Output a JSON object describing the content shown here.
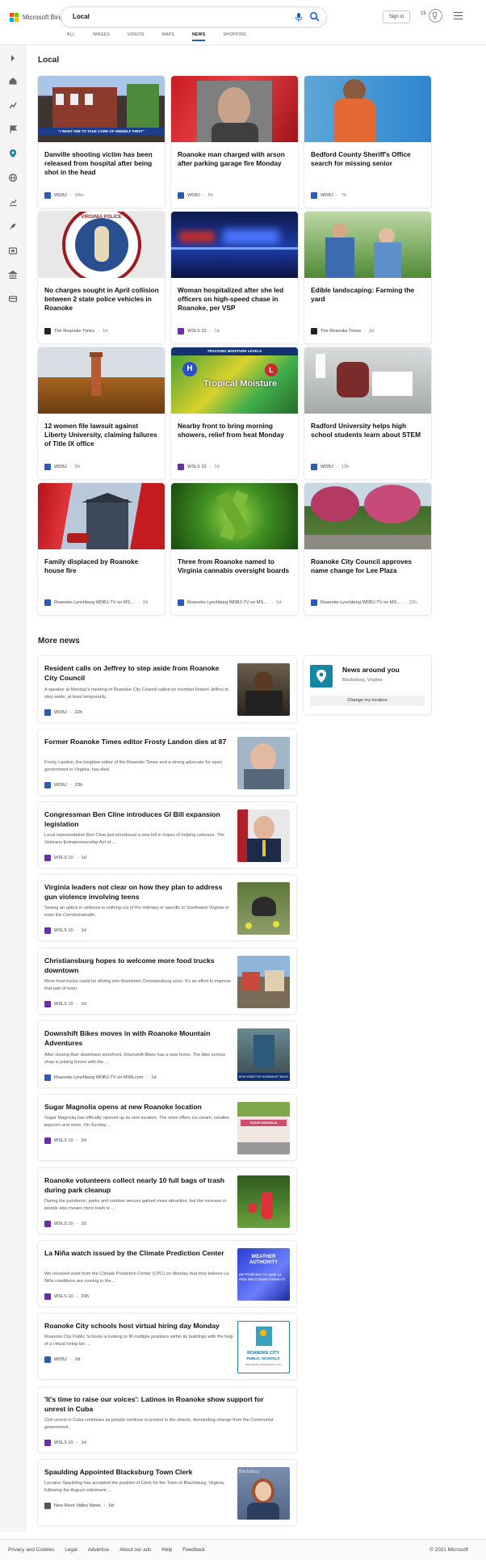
{
  "brand": {
    "name": "Microsoft Bing",
    "colors": [
      "#f25022",
      "#7fba00",
      "#00a4ef",
      "#ffb900"
    ]
  },
  "search": {
    "query": "Local"
  },
  "header": {
    "sign_in": "Sign in",
    "reward_count": "15"
  },
  "tabs": [
    {
      "label": "ALL"
    },
    {
      "label": "IMAGES"
    },
    {
      "label": "VIDEOS"
    },
    {
      "label": "MAPS"
    },
    {
      "label": "NEWS",
      "active": true
    },
    {
      "label": "SHOPPING"
    }
  ],
  "accent": "#1f5fc5",
  "local": {
    "title": "Local",
    "cards": [
      {
        "title": "Danville shooting victim has been released from hospital after being shot in the head",
        "source": "WDBJ",
        "ago": "34m",
        "logo": "w",
        "img_caption": "\"I WANT HIM TO TAKE CARE OF HIMSELF FIRST\""
      },
      {
        "title": "Roanoke man charged with arson after parking garage fire Monday",
        "source": "WDBJ",
        "ago": "5h",
        "logo": "w"
      },
      {
        "title": "Bedford County Sheriff's Office search for missing senior",
        "source": "WDBJ",
        "ago": "7h",
        "logo": "w"
      },
      {
        "title": "No charges sought in April collision between 2 state police vehicles in Roanoke",
        "source": "The Roanoke Times",
        "ago": "1d",
        "logo": "t",
        "img_caption": "VIRGINIA POLICE"
      },
      {
        "title": "Woman hospitalized after she led officers on high-speed chase in Roanoke, per VSP",
        "source": "WSLS 10",
        "ago": "1d",
        "logo": "s"
      },
      {
        "title": "Edible landscaping: Farming the yard",
        "source": "The Roanoke Times",
        "ago": "2d",
        "logo": "t"
      },
      {
        "title": "12 women file lawsuit against Liberty University, claiming failures of Title IX office",
        "source": "WDBJ",
        "ago": "5h",
        "logo": "w"
      },
      {
        "title": "Nearby front to bring morning showers, relief from heat Monday",
        "source": "WSLS 10",
        "ago": "1d",
        "logo": "s",
        "img_caption": "TRACKING MOISTURE LEVELS",
        "img_caption2": "Tropical Moisture"
      },
      {
        "title": "Radford University helps high school students learn about STEM",
        "source": "WDBJ",
        "ago": "13h",
        "logo": "w"
      },
      {
        "title": "Family displaced by Roanoke house fire",
        "source": "Roanoke-Lynchburg WDBJ-TV on MSN...",
        "ago": "2d",
        "logo": "w"
      },
      {
        "title": "Three from Roanoke named to Virginia cannabis oversight boards",
        "source": "Roanoke-Lynchburg WDBJ-TV on MSN...",
        "ago": "1d",
        "logo": "w"
      },
      {
        "title": "Roanoke City Council approves name change for Lee Plaza",
        "source": "Roanoke-Lynchburg WDBJ-TV on MSN...",
        "ago": "22h",
        "logo": "w"
      }
    ]
  },
  "more_news": {
    "title": "More news",
    "items": [
      {
        "title": "Resident calls on Jeffrey to step aside from Roanoke City Council",
        "snippet": "A speaker at Monday's meeting of Roanoke City Council called on member Robert Jeffrey to step aside, at least temporarily.",
        "source": "WDBJ",
        "ago": "22h",
        "logo": "w"
      },
      {
        "title": "Former Roanoke Times editor Frosty Landon dies at 87",
        "snippet": "Frosty Landon, the longtime editor of the Roanoke Times and a strong advocate for open government in Virginia, has died.",
        "source": "WDBJ",
        "ago": "23h",
        "logo": "w"
      },
      {
        "title": "Congressman Ben Cline introduces GI Bill expansion legislation",
        "snippet": "Local representative Ben Cline just introduced a new bill in hopes of helping veterans. The Veterans Entrepreneurship Act of ...",
        "source": "WSLS 10",
        "ago": "1d",
        "logo": "s"
      },
      {
        "title": "Virginia leaders not clear on how they plan to address gun violence involving teens",
        "snippet": "Seeing an uptick in violence is nothing out of the ordinary or specific to Southwest Virginia or even the Commonwealth.",
        "source": "WSLS 10",
        "ago": "1d",
        "logo": "s"
      },
      {
        "title": "Christiansburg hopes to welcome more food trucks downtown",
        "snippet": "More food trucks could be driving into downtown Christiansburg soon. It's an effort to improve that part of town.",
        "source": "WSLS 10",
        "ago": "1d",
        "logo": "s"
      },
      {
        "title": "Downshift Bikes moves in with Roanoke Mountain Adventures",
        "snippet": "After closing their downtown storefront, Downshift Bikes has a new home. The bike service shop is joining forces with the ...",
        "source": "Roanoke-Lynchburg WDBJ-TV on MSN.com",
        "ago": "1d",
        "logo": "w",
        "img_caption": "NEW HOME FOR DOWNSHIFT BIKES"
      },
      {
        "title": "Sugar Magnolia opens at new Roanoke location",
        "snippet": "Sugar Magnolia has officially opened up its new location. The store offers ice cream, candies popcorn and more. On Sunday ...",
        "source": "WSLS 10",
        "ago": "2d",
        "logo": "s",
        "img_caption": "SUGAR MAGNOLIA"
      },
      {
        "title": "Roanoke volunteers collect nearly 10 full bags of trash during park cleanup",
        "snippet": "During the pandemic, parks and outdoor venues gained more attraction, but the increase in people also means more trash is ...",
        "source": "WSLS 10",
        "ago": "2d",
        "logo": "s"
      },
      {
        "title": "La Niña watch issued by the Climate Prediction Center",
        "snippet": "We received word from the Climate Prediction Center (CPC) on Monday that they believe La Niña conditions are coming in the ...",
        "source": "WSLS 10",
        "ago": "20h",
        "logo": "s",
        "img_caption": "WEATHER AUTHORITY",
        "img_caption2": "ate Prediction Ce sues La Niña Wat it Doesn't Mean fo"
      },
      {
        "title": "Roanoke City schools host virtual hiring day Monday",
        "snippet": "Roanoke City Public Schools is looking to fill multiple positions within its buildings with the help of a virtual hiring fair ...",
        "source": "WDBJ",
        "ago": "2d",
        "logo": "w",
        "img_caption": "ROANOKE CITY",
        "img_caption2": "PUBLIC SCHOOLS",
        "img_caption3": "Extraordinary things happen here"
      },
      {
        "title": "'It's time to raise our voices': Latinos in Roanoke show support for unrest in Cuba",
        "snippet": "Civil unrest in Cuba continues as people continue to protest in the streets, demanding change from the Communist government.",
        "source": "WSLS 10",
        "ago": "1d",
        "logo": "s"
      },
      {
        "title": "Spaulding Appointed Blacksburg Town Clerk",
        "snippet": "Lorraine Spaulding has accepted the position of Clerk for the Town of Blacksburg, Virginia, following the August retirement ...",
        "source": "New River Valley News",
        "ago": "6d",
        "logo": "n",
        "img_caption": "Blacksburg"
      }
    ]
  },
  "news_around_you": {
    "title": "News around you",
    "location": "Blacksburg, Virginia",
    "button": "Change my location"
  },
  "footer": {
    "links": [
      "Privacy and Cookies",
      "Legal",
      "Advertise",
      "About our ads",
      "Help",
      "Feedback"
    ],
    "copyright": "© 2021 Microsoft"
  }
}
